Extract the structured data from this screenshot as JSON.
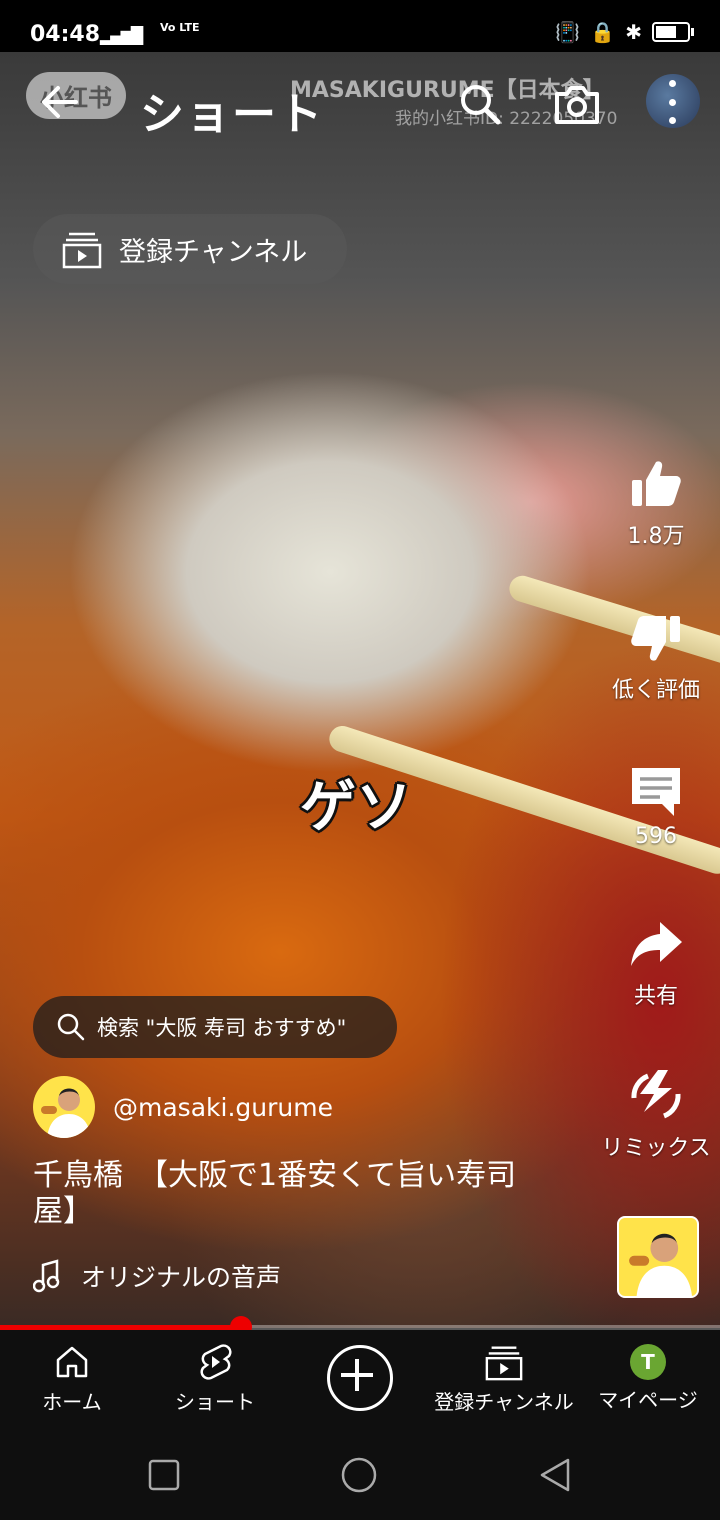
{
  "status_bar": {
    "time": "04:48",
    "network": "Vo LTE"
  },
  "top_bar": {
    "title": "ショート",
    "watermark_logo": "小红书",
    "watermark_channel": "MASAKIGURUME【日本食】",
    "watermark_id": "我的小红书ID: 2222050370"
  },
  "subscriptions_chip": {
    "label": "登録チャンネル"
  },
  "video": {
    "overlay_caption": "ゲソ",
    "search_suggestion": "検索 \"大阪 寿司 おすすめ\"",
    "channel_handle": "@masaki.gurume",
    "title": "千鳥橋　【大阪で1番安くて旨い寿司屋】",
    "audio_label": "オリジナルの音声",
    "progress_fraction": 0.335
  },
  "actions": {
    "like_count": "1.8万",
    "dislike_label": "低く評価",
    "comment_count": "596",
    "share_label": "共有",
    "remix_label": "リミックス"
  },
  "bottom_nav": {
    "home": "ホーム",
    "shorts": "ショート",
    "subscriptions": "登録チャンネル",
    "profile": "マイページ",
    "profile_initial": "T"
  },
  "colors": {
    "accent": "#ff0000",
    "avatar_yellow": "#ffe34a",
    "profile_green": "#6aa632"
  }
}
